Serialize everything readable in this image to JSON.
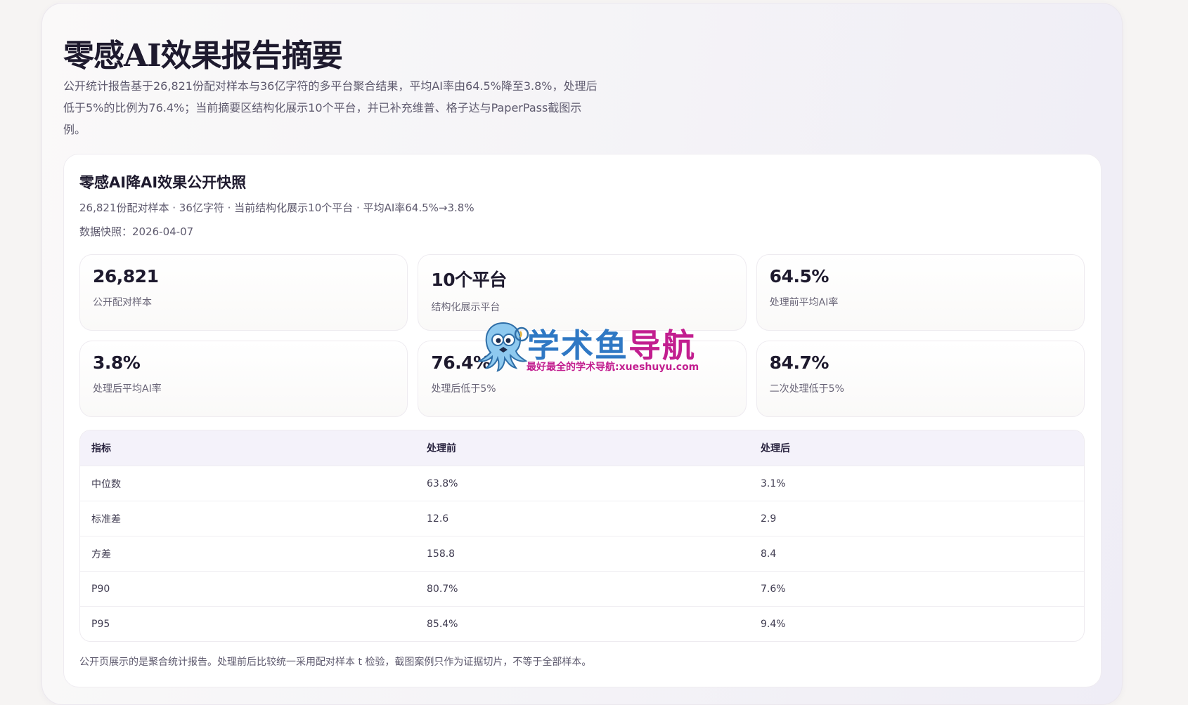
{
  "hero": {
    "title": "零感AI效果报告摘要",
    "description": "公开统计报告基于26,821份配对样本与36亿字符的多平台聚合结果，平均AI率由64.5%降至3.8%，处理后低于5%的比例为76.4%；当前摘要区结构化展示10个平台，并已补充维普、格子达与PaperPass截图示例。"
  },
  "snapshot": {
    "title": "零感AI降AI效果公开快照",
    "meta": "26,821份配对样本 · 36亿字符 · 当前结构化展示10个平台 · 平均AI率64.5%→3.8%",
    "date": "数据快照：2026-04-07",
    "stats": [
      {
        "value": "26,821",
        "label": "公开配对样本"
      },
      {
        "value": "10个平台",
        "label": "结构化展示平台"
      },
      {
        "value": "64.5%",
        "label": "处理前平均AI率"
      },
      {
        "value": "3.8%",
        "label": "处理后平均AI率"
      },
      {
        "value": "76.4%",
        "label": "处理后低于5%"
      },
      {
        "value": "84.7%",
        "label": "二次处理低于5%"
      }
    ],
    "table": {
      "headers": [
        "指标",
        "处理前",
        "处理后"
      ],
      "rows": [
        [
          "中位数",
          "63.8%",
          "3.1%"
        ],
        [
          "标准差",
          "12.6",
          "2.9"
        ],
        [
          "方差",
          "158.8",
          "8.4"
        ],
        [
          "P90",
          "80.7%",
          "7.6%"
        ],
        [
          "P95",
          "85.4%",
          "9.4%"
        ]
      ]
    },
    "footnote": "公开页展示的是聚合统计报告。处理前后比较统一采用配对样本 t 检验，截图案例只作为证据切片，不等于全部样本。"
  },
  "watermark": {
    "name_part1": "学术鱼",
    "name_part2": "导航",
    "tagline": "最好最全的学术导航:xueshuyu.com",
    "icon": "octopus-mascot-icon"
  }
}
